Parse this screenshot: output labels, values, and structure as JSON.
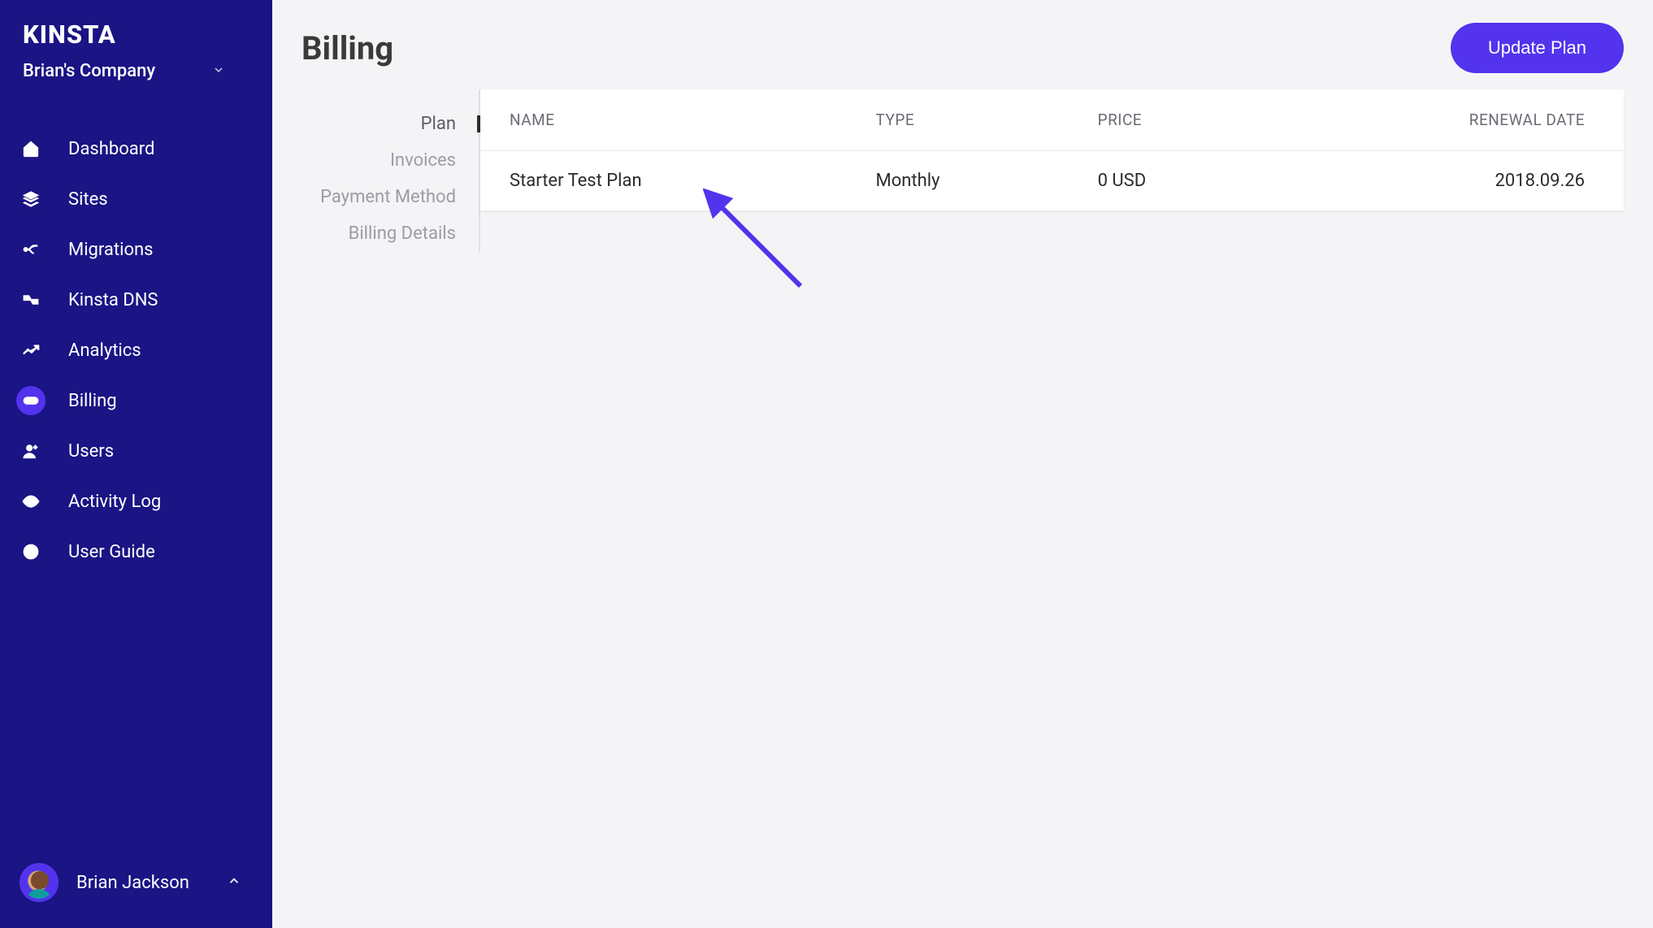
{
  "brand": "KINSTA",
  "company_name": "Brian's Company",
  "sidebar": {
    "items": [
      {
        "label": "Dashboard",
        "icon": "home"
      },
      {
        "label": "Sites",
        "icon": "layers"
      },
      {
        "label": "Migrations",
        "icon": "migrate"
      },
      {
        "label": "Kinsta DNS",
        "icon": "dns"
      },
      {
        "label": "Analytics",
        "icon": "analytics"
      },
      {
        "label": "Billing",
        "icon": "billing",
        "active": true
      },
      {
        "label": "Users",
        "icon": "users"
      },
      {
        "label": "Activity Log",
        "icon": "eye"
      },
      {
        "label": "User Guide",
        "icon": "help"
      }
    ]
  },
  "user": {
    "name": "Brian Jackson"
  },
  "page": {
    "title": "Billing",
    "update_button": "Update Plan"
  },
  "subnav": {
    "items": [
      {
        "label": "Plan",
        "active": true
      },
      {
        "label": "Invoices"
      },
      {
        "label": "Payment Method"
      },
      {
        "label": "Billing Details"
      }
    ]
  },
  "plan_table": {
    "headers": {
      "name": "NAME",
      "type": "TYPE",
      "price": "PRICE",
      "renewal": "RENEWAL DATE"
    },
    "rows": [
      {
        "name": "Starter Test Plan",
        "type": "Monthly",
        "price": "0 USD",
        "renewal": "2018.09.26"
      }
    ]
  }
}
